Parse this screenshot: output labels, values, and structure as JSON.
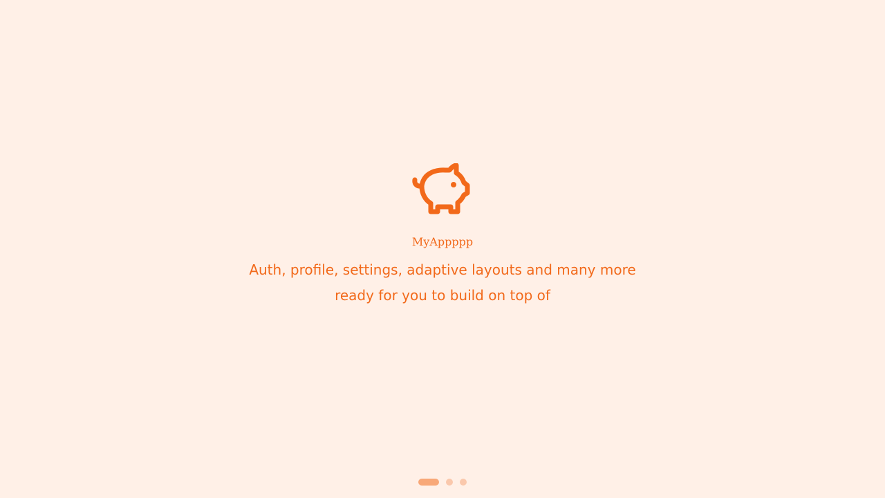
{
  "app": {
    "name": "MyAppppp",
    "tagline": "Auth, profile, settings, adaptive layouts and many more ready for you to build on top of",
    "logo_icon": "piggy-bank-icon"
  },
  "pager": {
    "total": 3,
    "active_index": 0
  },
  "colors": {
    "background": "#FFF0E7",
    "accent": "#F2691A",
    "dot_active": "#F8A878",
    "dot_inactive": "#FAC8AC"
  }
}
